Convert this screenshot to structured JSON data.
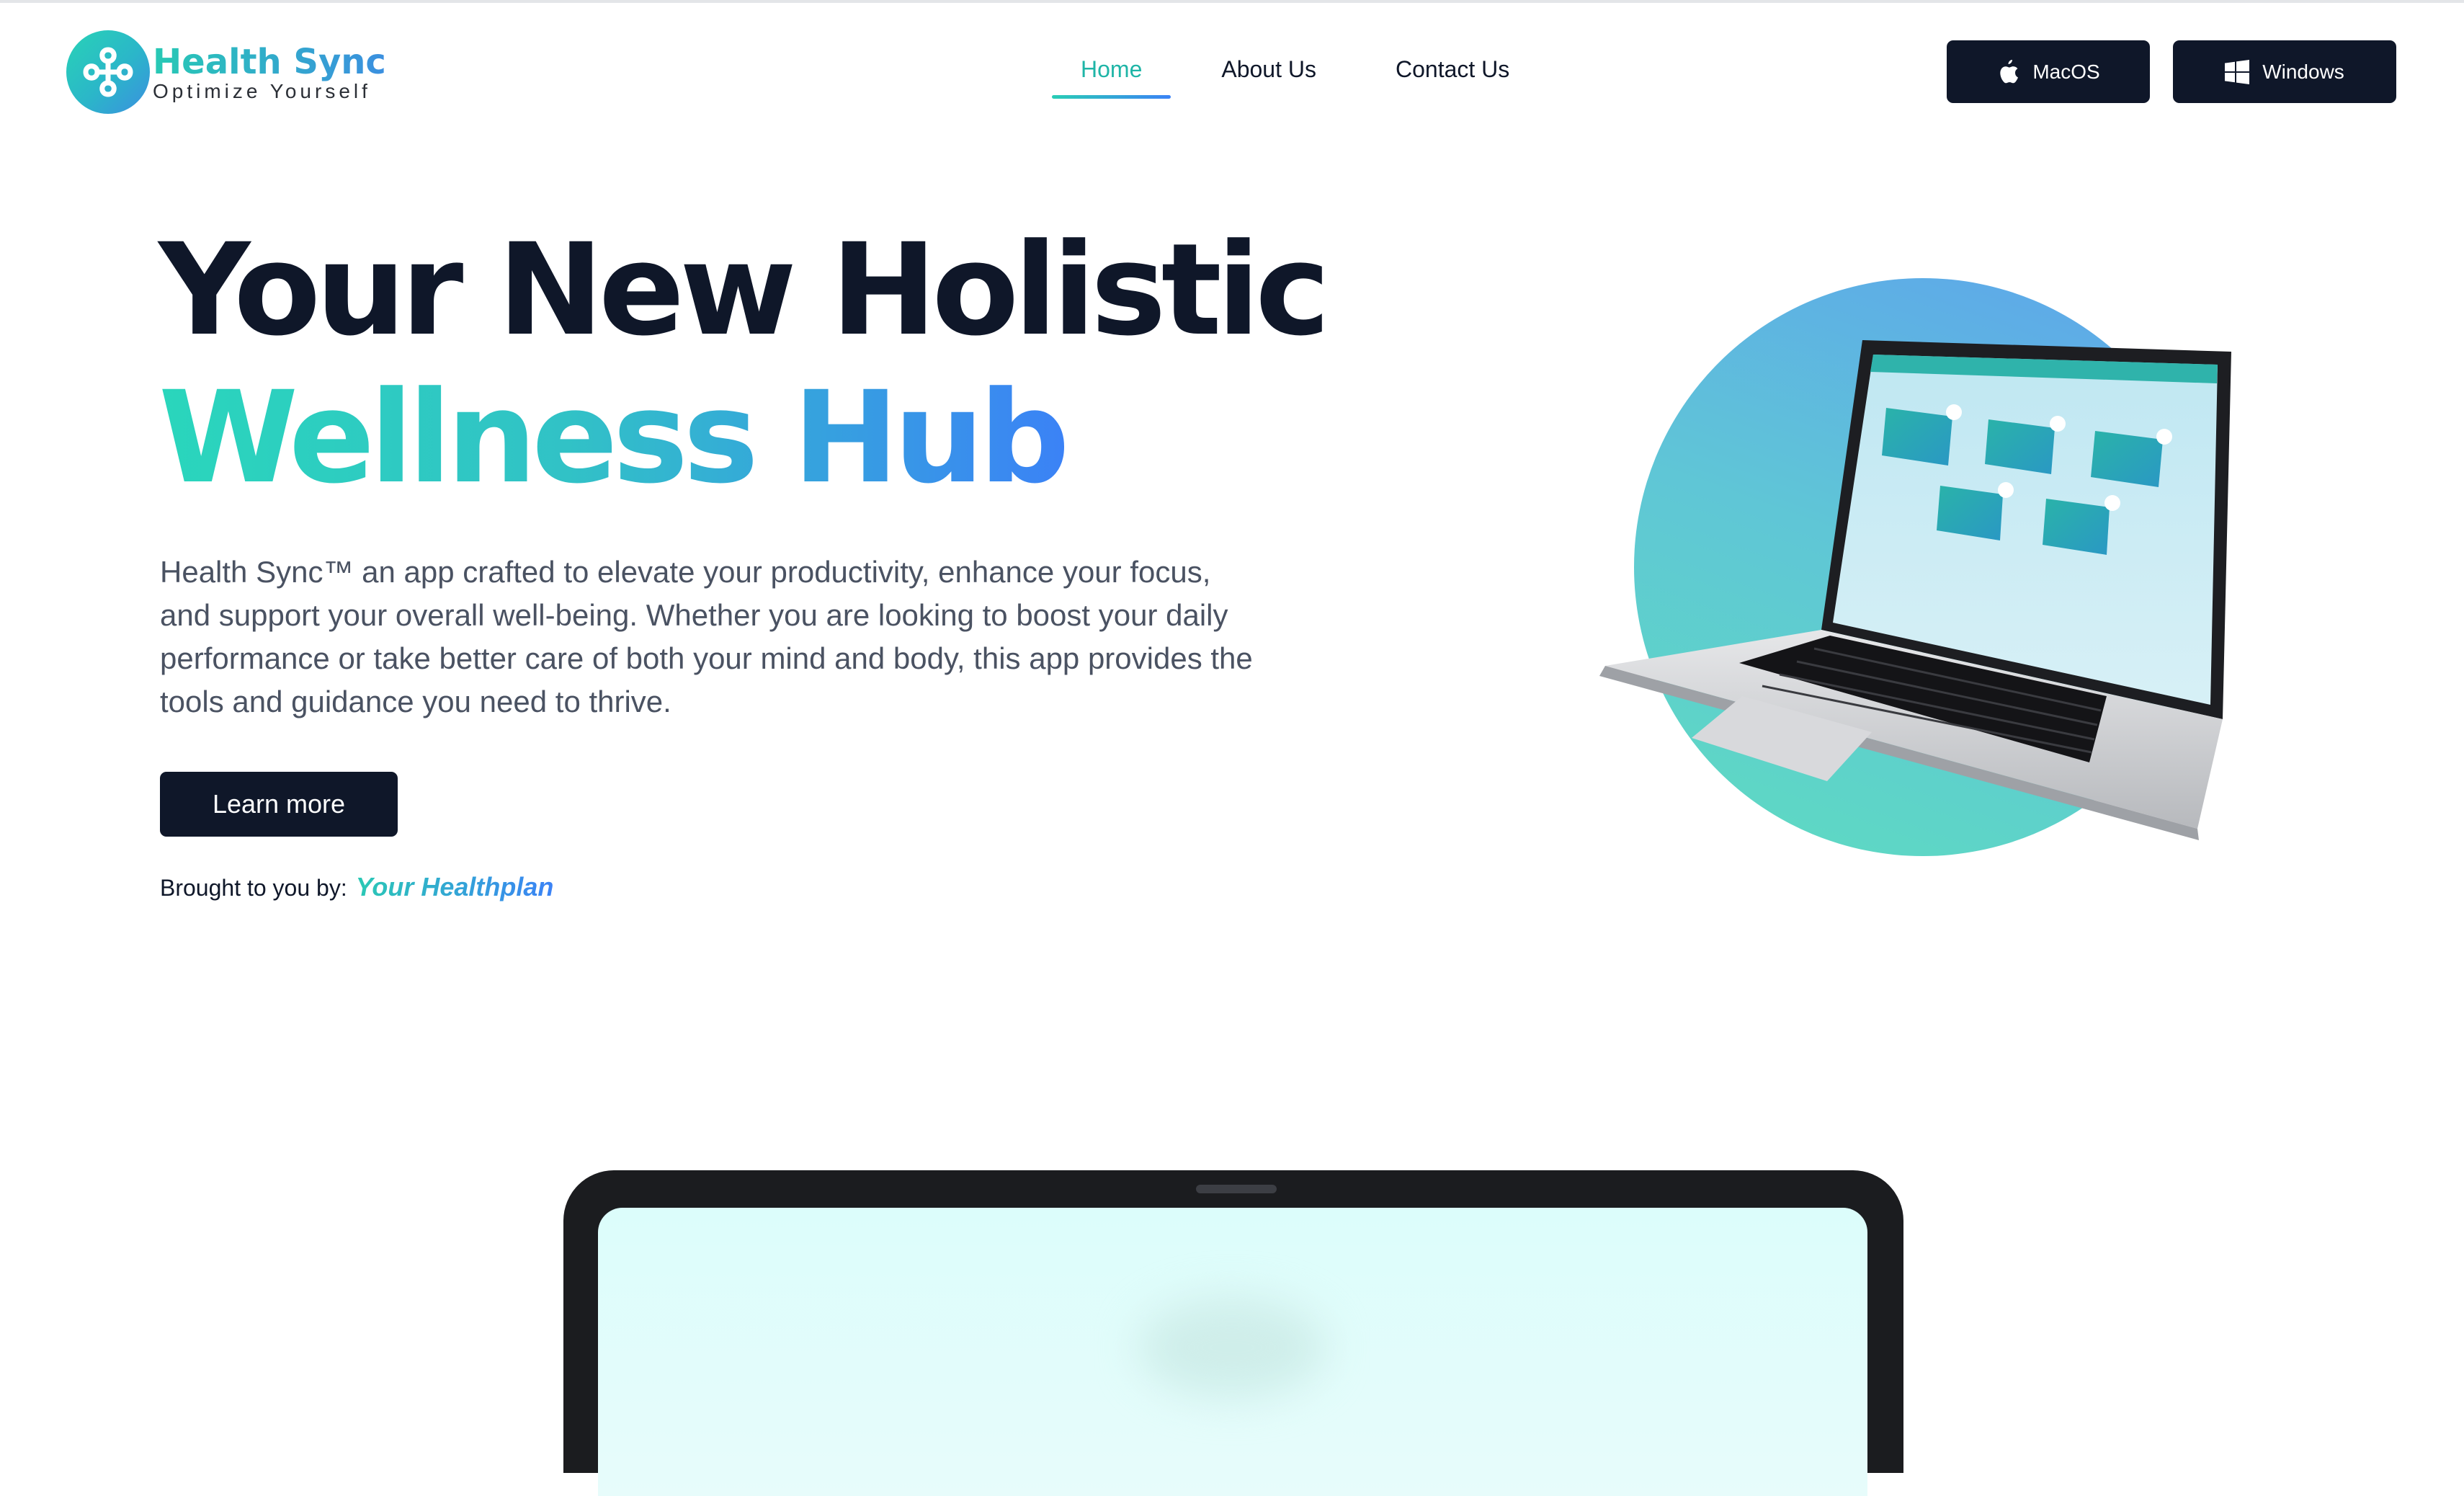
{
  "brand": {
    "title": "Health Sync",
    "tagline": "Optimize Yourself"
  },
  "nav": {
    "items": [
      {
        "label": "Home",
        "active": true
      },
      {
        "label": "About Us",
        "active": false
      },
      {
        "label": "Contact Us",
        "active": false
      }
    ]
  },
  "downloads": {
    "mac_label": "MacOS",
    "windows_label": "Windows"
  },
  "hero": {
    "title_line1": "Your New Holistic",
    "title_line2": "Wellness Hub",
    "description": "Health Sync™ an app crafted to elevate your productivity, enhance your focus, and support your overall well-being. Whether you are looking to boost your daily performance or take better care of both your mind and body, this app provides the tools and guidance you need to thrive.",
    "cta_label": "Learn more",
    "brought_by_label": "Brought to you by:",
    "brought_by_link": "Your Healthplan"
  },
  "colors": {
    "accent_teal": "#29cdb5",
    "accent_blue": "#3b82f6",
    "dark": "#0f1729",
    "body_text": "#4a5262"
  },
  "icons": {
    "logo": "health-sync-logo-icon",
    "mac": "apple-icon",
    "windows": "windows-icon"
  }
}
